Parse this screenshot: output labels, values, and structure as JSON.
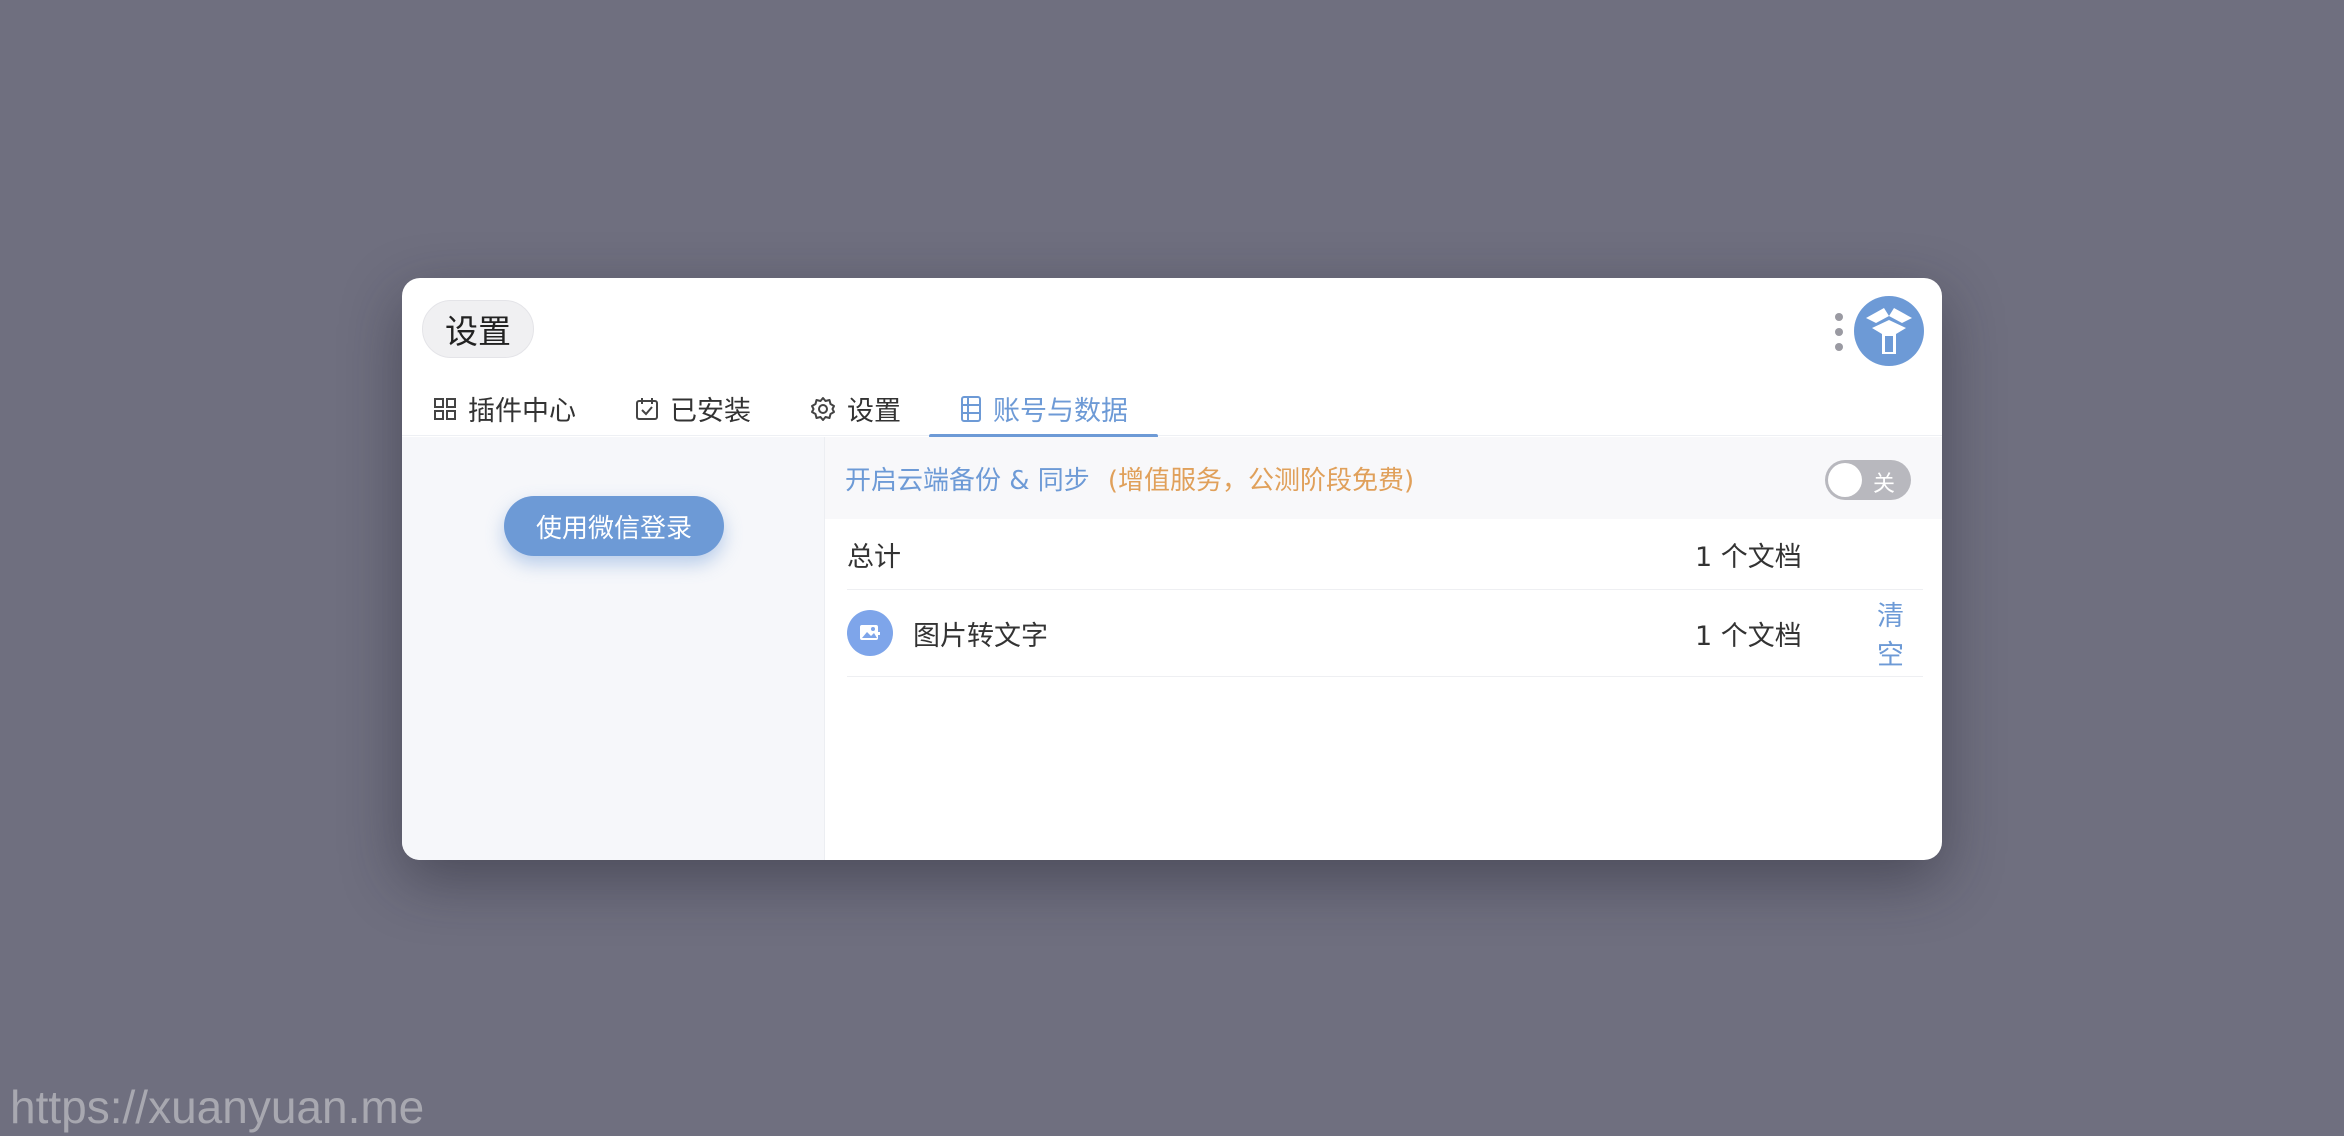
{
  "window": {
    "title": "设置"
  },
  "tabs": [
    {
      "label": "插件中心",
      "icon": "grid-icon"
    },
    {
      "label": "已安装",
      "icon": "calendar-check-icon"
    },
    {
      "label": "设置",
      "icon": "gear-icon"
    },
    {
      "label": "账号与数据",
      "icon": "document-icon",
      "active": true
    }
  ],
  "left": {
    "login_button": "使用微信登录"
  },
  "sync": {
    "title": "开启云端备份 & 同步",
    "note": "(增值服务，公测阶段免费)",
    "toggle_label": "关",
    "toggle_on": false
  },
  "summary": {
    "label": "总计",
    "count": "1 个文档"
  },
  "items": [
    {
      "name": "图片转文字",
      "count": "1 个文档",
      "action": "清空",
      "icon": "image-icon"
    }
  ],
  "watermark": "https://xuanyuan.me",
  "colors": {
    "accent": "#6d9ad6",
    "note": "#e0a05a",
    "background": "#6f6f7f"
  }
}
